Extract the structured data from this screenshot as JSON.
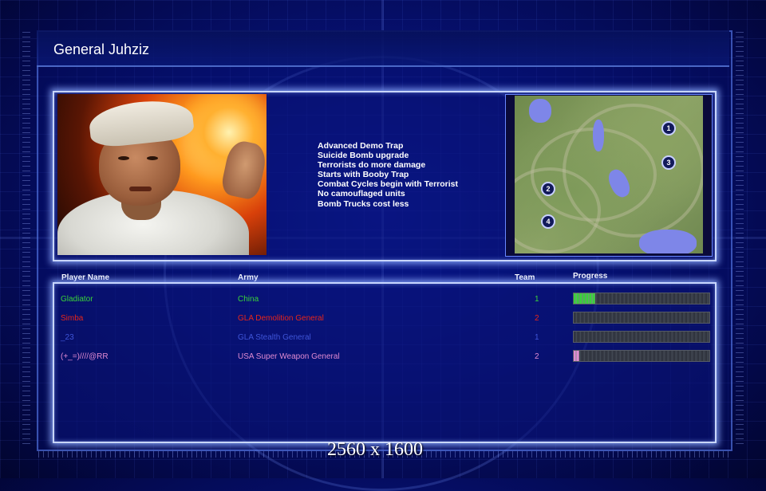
{
  "header": {
    "title": "General Juhziz"
  },
  "general": {
    "portrait_alt": "GLA general portrait",
    "traits": [
      "Advanced Demo Trap",
      "Suicide Bomb upgrade",
      "Terrorists do more damage",
      "Starts with Booby Trap",
      "Combat Cycles begin with Terrorist",
      "No camouflaged units",
      "Bomb Trucks cost less"
    ]
  },
  "minimap": {
    "start_positions": [
      "1",
      "2",
      "3",
      "4"
    ]
  },
  "players_table": {
    "headers": {
      "name": "Player Name",
      "army": "Army",
      "team": "Team",
      "progress": "Progress"
    },
    "rows": [
      {
        "name": "Gladiator",
        "army": "China",
        "team": "1",
        "progress": 0.16,
        "color": "#39d23a"
      },
      {
        "name": "Simba",
        "army": "GLA Demolition General",
        "team": "2",
        "progress": 0.0,
        "color": "#e8251a"
      },
      {
        "name": "_23",
        "army": "GLA Stealth General",
        "team": "1",
        "progress": 0.0,
        "color": "#3f55d8"
      },
      {
        "name": "(+_=)////@RR",
        "army": "USA Super Weapon General",
        "team": "2",
        "progress": 0.04,
        "color": "#e08ad2"
      }
    ]
  },
  "footer": {
    "resolution": "2560 x 1600"
  }
}
